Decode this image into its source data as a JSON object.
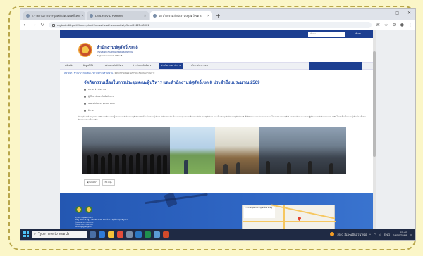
{
  "browser": {
    "tabs": [
      {
        "title": "c.รายงานการประชุมหลักสัตวแพทย์ไทย",
        "active": false
      },
      {
        "title": "DSA-ecoVID Platform",
        "active": false
      },
      {
        "title": "ข่าวกิจกรรมสำนักงานปศุสัตว์เขต 8",
        "active": true
      }
    ],
    "new_tab": "+",
    "window_controls": [
      "–",
      "□",
      "✕"
    ],
    "url": "region8.dld.go.th/index.php/th/news-head/news-activity/item/91125-60001"
  },
  "site": {
    "top_search_placeholder": "ค้นหา",
    "top_search_button": "ค้นหา",
    "org_name": "สำนักงานปศุสัตว์เขต 8",
    "org_subtitle": "กรมปศุสัตว์ กระทรวงเกษตรและสหกรณ์",
    "org_en": "Regional Livestock Office 8",
    "menu": [
      {
        "label": "หน้าหลัก",
        "active": false
      },
      {
        "label": "ข้อมูลทั่วไป ▾",
        "active": false
      },
      {
        "label": "หน่วยงานในสังกัด ▾",
        "active": false
      },
      {
        "label": "ข่าวประชาสัมพันธ์ ▾",
        "active": false
      },
      {
        "label": "ข่าวกิจกรรมสำนักงาน",
        "active": true
      },
      {
        "label": "บริการประชาชน ▾",
        "active": false
      }
    ],
    "breadcrumb": [
      "หน้าหลัก",
      "ข่าวประชาสัมพันธ์",
      "ข่าวกิจกรรมสำนักงาน",
      "จัดกิจกรรมเนื่องในการประชุมคณะกรรมการ"
    ],
    "article": {
      "title": "จัดกิจกรรมเนื่องในการประชุมคณะผู้บริหาร และสำนักงานปศุสัตว์เขต 8 ประจำปีงบประมาณ 2569",
      "meta": [
        "หมวด: ข่าวกิจกรรม",
        "ผู้เขียน: ประชาสัมพันธ์เขต 8",
        "เผยแพร่เมื่อ: 24 ตุลาคม 2568",
        "ฮิต: 15"
      ],
      "body": "วันพฤหัสบดีที่ 23 ตุลาคม 2568 นายสัตวแพทย์ผู้อำนวยการสำนักงานปศุสัตว์เขต 8 พร้อมด้วยคณะผู้บริหาร จัดกิจกรรมเนื่องในการประชุมประจำเดือนของสำนักงานปศุสัตว์เขต 8 ณ ห้องประชุมสำนักงานปศุสัตว์เขต 8 เพื่อติดตามผลการดำเนินงานตามนโยบายของกรมปศุสัตว์ และร่วมกันวางแผนการปฏิบัติงานประจำปีงบประมาณ 2569 โดยมีเจ้าหน้าที่และผู้เกี่ยวข้องเข้าร่วมกิจกรรมอย่างพร้อมเพรียง",
      "share_buttons": [
        "◀ ก่อนหน้า",
        "ถัดไป ▶"
      ]
    },
    "footer": {
      "org_name": "สำนักงานปศุสัตว์เขต 8",
      "address": "ที่อยู่: เลขที่ 99 หมู่ 1 ถนนเพชรเกษม ต.ท่าข้าม อ.พุนพิน จ.สุราษฎร์ธานี",
      "phone": "โทรศัพท์: 077-311-XXX",
      "fax": "โทรสาร: 077-311-XXX",
      "email": "อีเมล: rg8@dld.go.th",
      "map_card": "สำนักงานปศุสัตว์เขต 8 ดูแผนที่ขนาดใหญ่"
    }
  },
  "taskbar": {
    "search_placeholder": "Type here to search",
    "weather": "25°C มีเมฆเป็นส่วนใหญ่",
    "lang": "ENG",
    "time": "15:40",
    "date": "24/10/2568"
  },
  "colors": {
    "background": "#fbf6c8",
    "site_blue": "#1d3f91",
    "taskbar": "#1f2a44"
  }
}
